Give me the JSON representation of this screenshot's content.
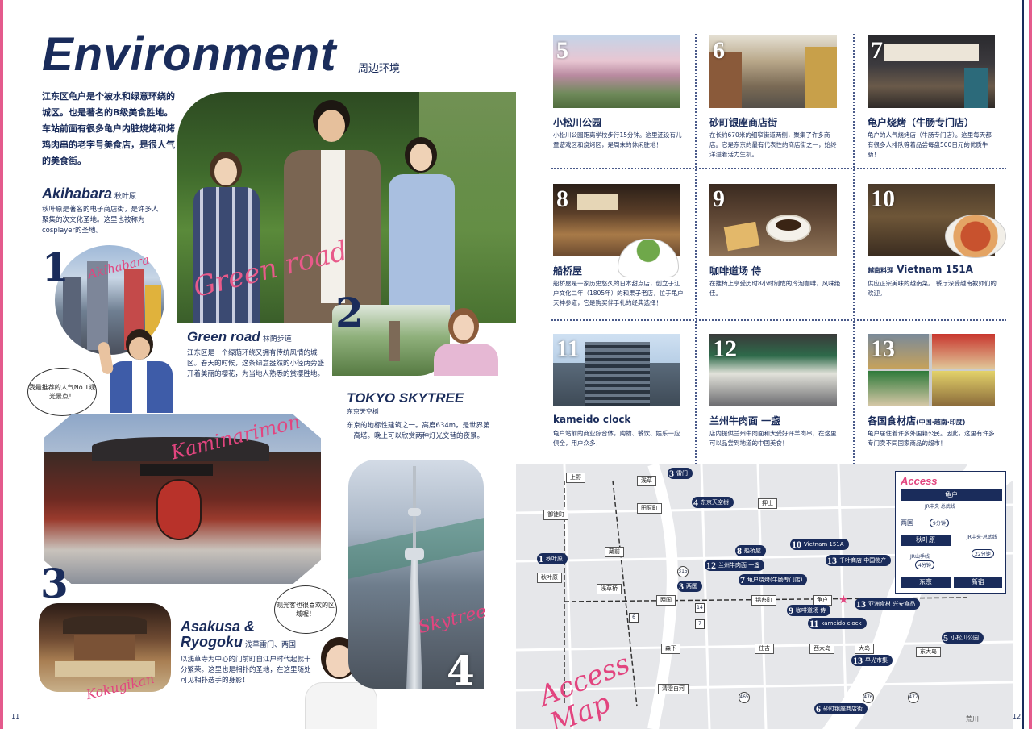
{
  "title": "Environment",
  "title_sub": "周边环境",
  "intro": "江东区龟户是个被水和绿意环绕的城区。也是著名的B级美食胜地。车站前面有很多龟户内脏烧烤和烤鸡肉串的老字号美食店，是很人气的美食街。",
  "akihabara": {
    "title": "Akihabara",
    "sub": "秋叶原",
    "desc": "秋叶原是著名的电子商店街，是许多人聚集的次文化圣地。这里也被称为cosplayer的圣地。",
    "num": "1",
    "script": "Akihabara"
  },
  "bubble1": "我最推荐的人气No.1观光景点！",
  "greenroad": {
    "title": "Green road",
    "sub": "林荫步道",
    "desc": "江东区是一个绿荫环绕又拥有传统风情的城区。春天的时候，这条绿意盎然的小径两旁盛开着美丽的樱花，为当地人熟悉的赏樱胜地。",
    "num": "2",
    "script": "Green road"
  },
  "kaminarimon_script": "Kaminarimon",
  "skytree": {
    "title": "TOKYO SKYTREE",
    "sub": "东京天空树",
    "desc": "东京的地标性建筑之一。高度634m，是世界第一高塔。晚上可以欣赏两种灯光交替的夜景。",
    "num": "4",
    "script": "Skytree"
  },
  "asakusa": {
    "title_l1": "Asakusa &",
    "title_l2": "Ryogoku",
    "sub": "浅草雷门、两国",
    "desc": "以浅草寺为中心的门前町自江户时代起就十分繁荣。这里也是相扑的圣地，在这里随处可见相扑选手的身影！",
    "num": "3",
    "script": "Kokugikan"
  },
  "bubble2": "观光客也很喜欢的区域喔！",
  "spots": [
    {
      "num": "5",
      "title": "小松川公园",
      "desc": "小松川公园距离学校步行15分钟。这里还设有儿童遊戏区和烧烤区，是周末的休闲胜地！"
    },
    {
      "num": "6",
      "title": "砂町银座商店街",
      "desc": "在长约670米的细窄街道两侧，聚集了许多商店。它是东京的最有代表性的商店街之一，始终洋溢着活力生机。"
    },
    {
      "num": "7",
      "title": "龟户烧烤（牛肠专门店）",
      "desc": "龟户的人气烧烤店（牛肠专门店）。这里每天都有很多人排队等着品尝每盘500日元的优质牛肠！"
    },
    {
      "num": "8",
      "title": "船桥屋",
      "desc": "船桥屋是一家历史悠久的日本甜点店，创立于江户文化二年（1805年）的和果子老店，位于龟户天神参道，它是购买伴手礼的经典选择！"
    },
    {
      "num": "9",
      "title": "咖啡道场 侍",
      "desc": "在推椅上享受历时8小时制成的冷泡咖啡，风味绝佳。"
    },
    {
      "num": "10",
      "title_pre": "越南料理",
      "title": "Vietnam 151A",
      "desc": "供应正宗美味的越南菜。 餐厅深受越南教师们的欢迎。"
    },
    {
      "num": "11",
      "title": "kameido clock",
      "desc": "龟户站前的商业综合体，购物、餐饮、娱乐一应俱全，用户众多！"
    },
    {
      "num": "12",
      "title": "兰州牛肉面 一盏",
      "desc": "店内提供兰州牛肉面和大受好评羊肉串，在这里可以品尝到地道的中国美食！"
    },
    {
      "num": "13",
      "title": "各国食材店",
      "title_post": "(中国·越南·印度)",
      "desc": "龟户居住着许多外国籍公民。因此，这里有许多专门卖不同国家商品的超市！"
    }
  ],
  "access_map_script": "Access Map",
  "map": {
    "stations": [
      "上野",
      "浅草",
      "田原町",
      "御徒町",
      "押上",
      "锦糸町",
      "秋叶原",
      "浅草桥",
      "两国",
      "锦糸町",
      "龟户",
      "森下",
      "住吉",
      "西大岛",
      "大岛",
      "东大岛",
      "清澄白河",
      "蔵前"
    ],
    "pins": [
      {
        "num": "1",
        "label": "秋叶原"
      },
      {
        "num": "3",
        "label": "雷门"
      },
      {
        "num": "4",
        "label": "东京天空树"
      },
      {
        "num": "8",
        "label": "船桥屋"
      },
      {
        "num": "12",
        "label": "兰州牛肉面 一盏"
      },
      {
        "num": "7",
        "label": "龟户烧烤(牛肠专门店)"
      },
      {
        "num": "3",
        "label": "两国"
      },
      {
        "num": "10",
        "label": "Vietnam 151A"
      },
      {
        "num": "13",
        "label": "千叶商店 中国物产"
      },
      {
        "num": "9",
        "label": "咖啡道场 侍"
      },
      {
        "num": "11",
        "label": "kameido clock"
      },
      {
        "num": "13",
        "label": "亚洲食材 兴安食品"
      },
      {
        "num": "5",
        "label": "小松川公园"
      },
      {
        "num": "13",
        "label": "早光市集"
      },
      {
        "num": "6",
        "label": "砂町银座商店街"
      }
    ],
    "routes": [
      "315",
      "465",
      "476",
      "477",
      "14",
      "7",
      "6"
    ],
    "river": "荒川"
  },
  "access": {
    "title": "Access",
    "kameido": "龟户",
    "line1": "JR中央·总武线",
    "time1": "9分钟",
    "ryogoku": "两国",
    "akihabara": "秋叶原",
    "line2": "JR中央·总武线",
    "time2": "22分钟",
    "line3": "JR山手线",
    "time3": "4分钟",
    "tokyo": "东京",
    "shinjuku": "新宿"
  },
  "page_left": "11",
  "page_right": "12"
}
